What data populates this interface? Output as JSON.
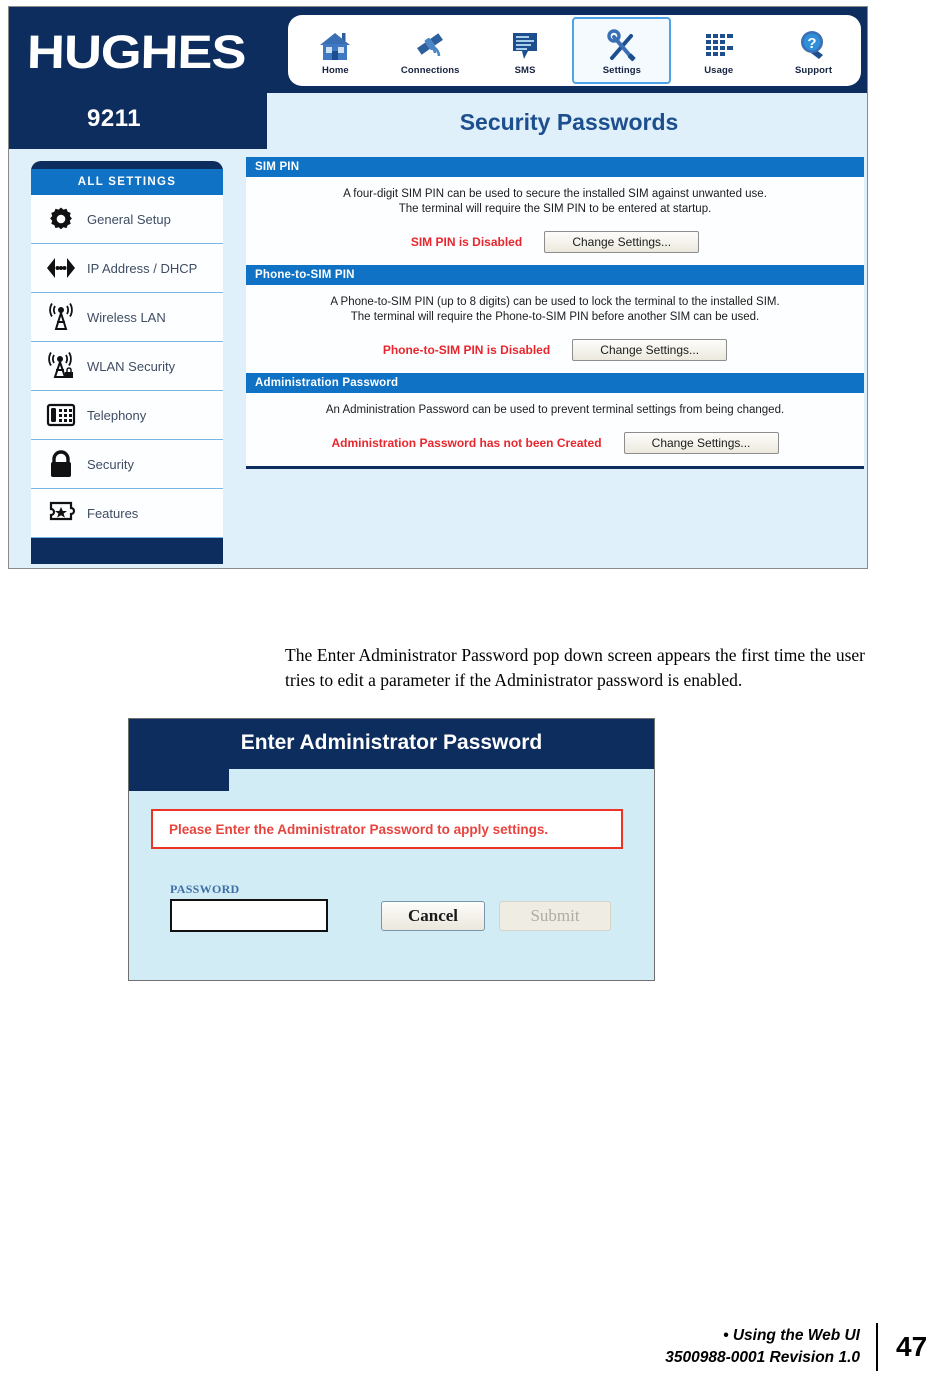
{
  "colors": {
    "navy": "#0d2d5e",
    "bright_blue": "#0f72c4",
    "pale_blue": "#dff0fa",
    "alert_red": "#e8443e",
    "title_blue": "#1d4f8f"
  },
  "screenshot_security": {
    "brand": "HUGHES",
    "model": "9211",
    "page_title": "Security Passwords",
    "nav": [
      {
        "label": "Home",
        "icon": "house-icon",
        "active": false
      },
      {
        "label": "Connections",
        "icon": "satellite-icon",
        "active": false
      },
      {
        "label": "SMS",
        "icon": "message-bubble-icon",
        "active": false
      },
      {
        "label": "Settings",
        "icon": "tools-icon",
        "active": true
      },
      {
        "label": "Usage",
        "icon": "grid-bars-icon",
        "active": false
      },
      {
        "label": "Support",
        "icon": "question-magnifier-icon",
        "active": false
      }
    ],
    "sidebar": {
      "title": "ALL SETTINGS",
      "items": [
        {
          "label": "General Setup",
          "icon": "gear-icon"
        },
        {
          "label": "IP Address / DHCP",
          "icon": "network-arrows-icon"
        },
        {
          "label": "Wireless LAN",
          "icon": "wifi-tower-icon"
        },
        {
          "label": "WLAN Security",
          "icon": "wifi-tower-lock-icon"
        },
        {
          "label": "Telephony",
          "icon": "desk-phone-icon"
        },
        {
          "label": "Security",
          "icon": "padlock-icon"
        },
        {
          "label": "Features",
          "icon": "puzzle-star-icon"
        }
      ]
    },
    "sections": [
      {
        "heading": "SIM PIN",
        "description_line1": "A four-digit SIM PIN can be used to secure the installed SIM against unwanted use.",
        "description_line2": "The terminal will require the SIM PIN to be entered at startup.",
        "status": "SIM PIN is Disabled",
        "button": "Change Settings..."
      },
      {
        "heading": "Phone-to-SIM PIN",
        "description_line1": "A Phone-to-SIM PIN (up to 8 digits) can be used to lock the terminal to the installed SIM.",
        "description_line2": "The terminal will require the Phone-to-SIM PIN before another SIM can be used.",
        "status": "Phone-to-SIM PIN is Disabled",
        "button": "Change Settings..."
      },
      {
        "heading": "Administration Password",
        "description_line1": "An Administration Password can be used to prevent terminal settings from being changed.",
        "description_line2": "",
        "status": "Administration Password has not been Created",
        "button": "Change Settings..."
      }
    ]
  },
  "body_text": {
    "paragraph": "The Enter Administrator Password pop down screen appears the first time the user tries to edit a parameter if the Administrator password is enabled."
  },
  "screenshot_dialog": {
    "title": "Enter Administrator Password",
    "alert": "Please Enter the Administrator Password to apply settings.",
    "password_label": "PASSWORD",
    "password_value": "",
    "password_placeholder": "",
    "cancel_label": "Cancel",
    "submit_label": "Submit",
    "submit_disabled": true
  },
  "footer": {
    "line1": "• Using the Web UI",
    "line2": "3500988-0001  Revision 1.0",
    "page_number": "47"
  }
}
